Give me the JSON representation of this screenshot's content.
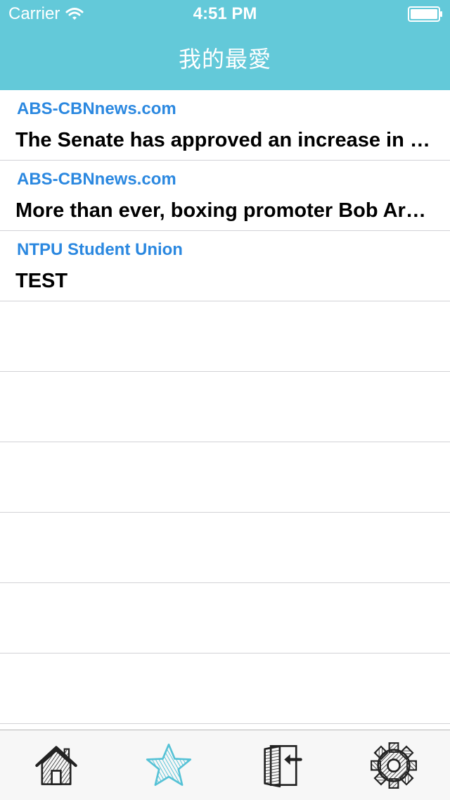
{
  "status_bar": {
    "carrier": "Carrier",
    "time": "4:51 PM"
  },
  "nav": {
    "title": "我的最愛"
  },
  "favorites": [
    {
      "source": "ABS-CBNnews.com",
      "title": "The Senate has approved an increase in the"
    },
    {
      "source": "ABS-CBNnews.com",
      "title": "More than ever, boxing promoter Bob Arum"
    },
    {
      "source": "NTPU Student Union",
      "title": "TEST"
    }
  ],
  "tab_bar": {
    "selected": "favorites-tab",
    "tabs": [
      {
        "icon": "home-icon"
      },
      {
        "icon": "star-icon"
      },
      {
        "icon": "exit-door-icon"
      },
      {
        "icon": "gear-icon"
      }
    ]
  },
  "colors": {
    "header": "#63c9d9",
    "source_text": "#2b88e0",
    "selected_tab": "#56c2d6",
    "separator": "#d2d2d6"
  }
}
